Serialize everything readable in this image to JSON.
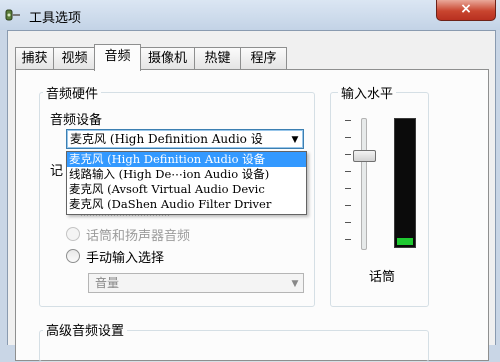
{
  "window": {
    "title": "工具选项",
    "close_symbol": "×"
  },
  "tabs": [
    {
      "label": "捕获",
      "active": false
    },
    {
      "label": "视频",
      "active": false
    },
    {
      "label": "音频",
      "active": true
    },
    {
      "label": "摄像机",
      "active": false
    },
    {
      "label": "热键",
      "active": false
    },
    {
      "label": "程序",
      "active": false
    }
  ],
  "audio_hardware": {
    "group_label": "音频硬件",
    "device_label": "音频设备",
    "device_value": "麦克风 (High Definition Audio 设",
    "dropdown_options": [
      "麦克风 (High Definition Audio 设备",
      "线路输入 (High De⋯ion Audio 设备)",
      "麦克风 (Avsoft Virtual Audio Devic",
      "麦克风 (DaShen Audio Filter Driver"
    ],
    "selected_option_index": 0,
    "record_label_partial": "记",
    "hidden_radio_partial": "⋯⋯⋯⋯⋯⋯⋯⋯⋯⋯",
    "radio_mic_speaker": "话筒和扬声器音频",
    "radio_manual": "手动输入选择",
    "manual_combo_value": "音量"
  },
  "input_level": {
    "group_label": "输入水平",
    "source_label": "话筒",
    "level_fraction": 0.06,
    "meter_color": "#1fc931"
  },
  "advanced": {
    "group_label": "高级音频设置"
  }
}
